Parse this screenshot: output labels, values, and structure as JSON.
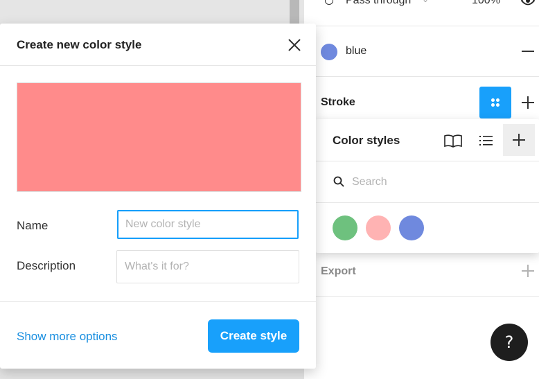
{
  "layer": {
    "blend_mode": "Pass through",
    "opacity": "100%"
  },
  "fill": {
    "style_name": "blue",
    "swatch_color": "#6f89de"
  },
  "stroke": {
    "title": "Stroke"
  },
  "export": {
    "title": "Export"
  },
  "color_styles_popover": {
    "title": "Color styles",
    "search_placeholder": "Search",
    "swatches": [
      {
        "color": "#6ec17e"
      },
      {
        "color": "#ffb3b3"
      },
      {
        "color": "#6f89de"
      }
    ]
  },
  "dialog": {
    "title": "Create new color style",
    "preview_color": "#ff8b8b",
    "name_label": "Name",
    "name_placeholder": "New color style",
    "description_label": "Description",
    "description_placeholder": "What's it for?",
    "more_options_link": "Show more options",
    "create_button": "Create style"
  },
  "help": {
    "label": "?"
  },
  "colors": {
    "accent": "#18a0fb",
    "link": "#1a8fe0"
  }
}
